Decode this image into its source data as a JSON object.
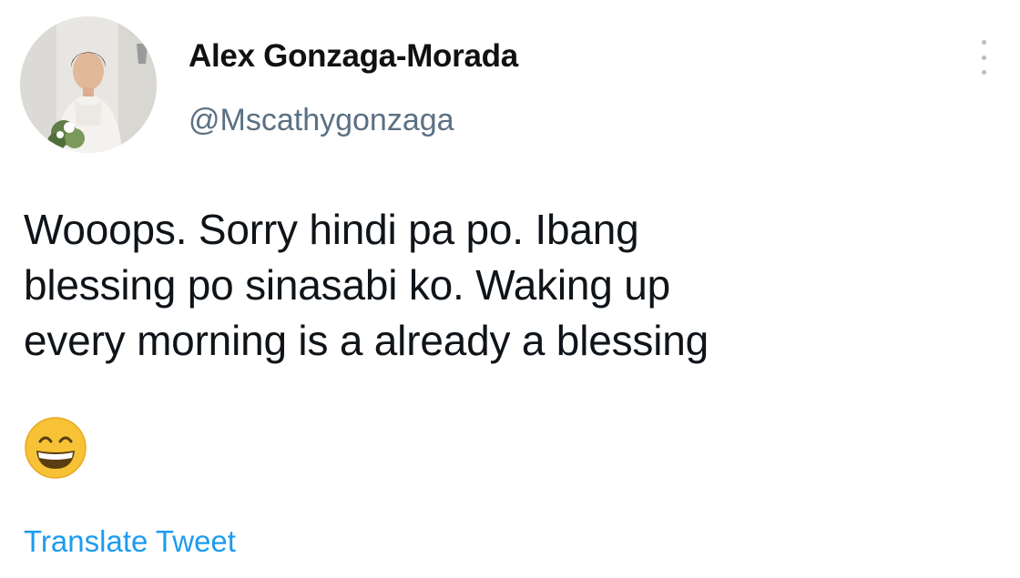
{
  "tweet": {
    "author": {
      "display_name": "Alex Gonzaga-Morada",
      "handle": "@Mscathygonzaga",
      "avatar_icon": "profile-photo"
    },
    "text_lines": [
      "Wooops. Sorry hindi pa po. Ibang",
      "blessing po sinasabi ko. Waking up",
      "every morning is a already a blessing"
    ],
    "emoji": "grinning-face-with-smiling-eyes",
    "more_icon": "vertical-ellipsis",
    "translate_label": "Translate Tweet"
  },
  "colors": {
    "background": "#ffffff",
    "name": "#111111",
    "handle": "#5b7083",
    "body_text": "#0f1419",
    "link": "#1d9bf0",
    "emoji_face": "#f7c235"
  }
}
